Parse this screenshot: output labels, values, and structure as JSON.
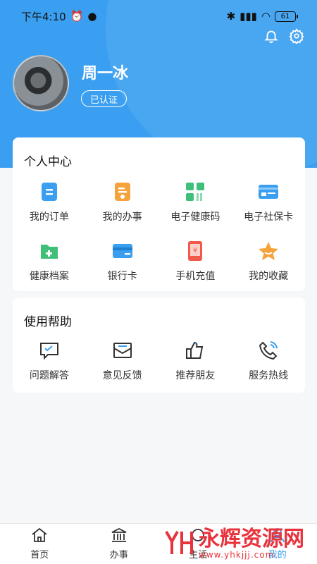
{
  "status_bar": {
    "time": "下午4:10",
    "battery": "61"
  },
  "profile": {
    "name": "周一冰",
    "badge": "已认证"
  },
  "personal_center": {
    "title": "个人中心",
    "items": [
      {
        "label": "我的订单",
        "icon": "order-icon",
        "color": "#3a9ff0"
      },
      {
        "label": "我的办事",
        "icon": "affairs-icon",
        "color": "#f5a33a"
      },
      {
        "label": "电子健康码",
        "icon": "health-code-icon",
        "color": "#3fbf7a"
      },
      {
        "label": "电子社保卡",
        "icon": "social-card-icon",
        "color": "#3a9ff0"
      },
      {
        "label": "健康档案",
        "icon": "health-file-icon",
        "color": "#3fbf7a"
      },
      {
        "label": "银行卡",
        "icon": "bank-card-icon",
        "color": "#3a9ff0"
      },
      {
        "label": "手机充值",
        "icon": "phone-recharge-icon",
        "color": "#ef5a4a"
      },
      {
        "label": "我的收藏",
        "icon": "star-icon",
        "color": "#f5a33a"
      }
    ]
  },
  "help": {
    "title": "使用帮助",
    "items": [
      {
        "label": "问题解答",
        "icon": "faq-icon"
      },
      {
        "label": "意见反馈",
        "icon": "feedback-icon"
      },
      {
        "label": "推荐朋友",
        "icon": "thumbs-up-icon"
      },
      {
        "label": "服务热线",
        "icon": "phone-icon"
      }
    ]
  },
  "bottom_nav": [
    {
      "label": "首页",
      "icon": "home-icon"
    },
    {
      "label": "办事",
      "icon": "bank-icon"
    },
    {
      "label": "生活",
      "icon": "life-icon"
    },
    {
      "label": "我的",
      "icon": "user-icon",
      "active": true
    }
  ],
  "watermark": {
    "text": "永辉资源网",
    "url": "www.yhkjjj.com"
  },
  "colors": {
    "primary": "#3a9ff0",
    "background": "#f6f7f9"
  }
}
